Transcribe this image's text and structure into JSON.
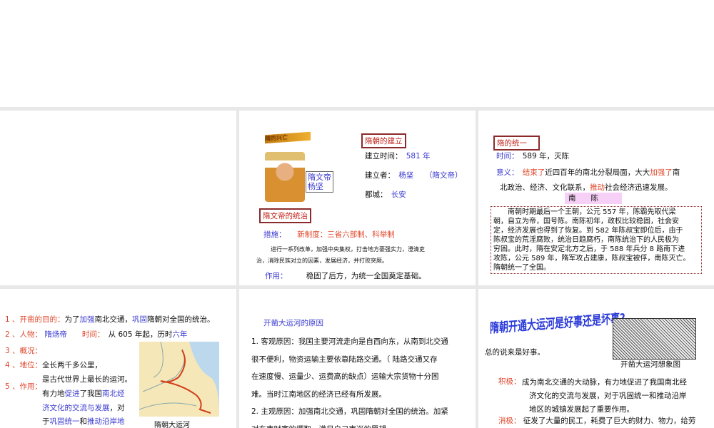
{
  "slide2": {
    "title_art": "隋的兴亡",
    "portrait_label_1": "隋文帝",
    "portrait_label_2": "杨坚",
    "founding_heading": "隋朝的建立",
    "time_label": "建立时间：",
    "time_value": "581 年",
    "founder_label": "建立者：",
    "founder_value": "杨坚",
    "founder_alias": "（隋文帝）",
    "capital_label": "都城：",
    "capital_value": "长安",
    "rule_heading": "隋文帝的统治",
    "measures_label": "措施：",
    "measures_value": "新制度：三省六部制、科举制",
    "detail_line1": "进行一系列改革，加强中央集权，打击地方豪强实力，澄清吏",
    "detail_line2": "治，消除民族对立的因素，发展经济，并打败突厥。",
    "effect_label": "作用：",
    "effect_value": "稳固了后方，为统一全国奠定基础。"
  },
  "slide3": {
    "heading": "隋的统一",
    "time_label": "时间：",
    "time_value": "589 年，灭陈",
    "meaning_label": "意义：",
    "m1": "结束了",
    "m2": "近四百年的南北分裂局面，大大",
    "m3": "加强了",
    "m4": "南",
    "m5": "北政治、经济、文化联系，",
    "m6": "推动",
    "m7": "社会经济迅速发展。",
    "chen_title": "南　　陈",
    "chen_lines": [
      "　　南朝时期最后一个王朝，公元 557 年，陈霸先取代梁",
      "朝，自立为帝，国号陈。南陈初年，政权比较稳固，社会安",
      "定，经济发展也得到了恢复。到 582 年陈叔宝即位后，由于",
      "陈叔宝的荒淫腐败，统治日趋腐朽，南陈统治下的人民极为",
      "穷困。此时，隋在安定北方之后，于 588 年兵分 8 路南下进",
      "攻陈，公元 589 年，隋军攻占建康，陈叔宝被俘，南陈灭亡。",
      "隋朝统一了全国。"
    ]
  },
  "slide4": {
    "l1a": "1 、开凿的目的：",
    "l1b": "为了",
    "l1c": "加强",
    "l1d": "南北交通，",
    "l1e": "巩固",
    "l1f": "隋朝对全国的统治。",
    "l2a": "2 、人物：",
    "l2b": "隋炀帝",
    "l2c": "时间：",
    "l2d": "从 605 年起，历时",
    "l2e": "六年",
    "l3": "3 、概况：",
    "l4a": "4 、地位：",
    "l4b": "全长两千多公里，",
    "l4c": "是古代世界上最长的运河。",
    "l5a": "5 、作用：",
    "r1a": "有力地",
    "r1b": "促进",
    "r1c": "了我国",
    "r1d": "南北经",
    "r2a": "济文化的交流与发展",
    "r2b": "，对",
    "r3a": "于",
    "r3b": "巩固统一",
    "r3c": "和",
    "r3d": "推动沿岸地",
    "map_caption": "隋朝大运河"
  },
  "slide5": {
    "heading": "开凿大运河的原因",
    "lines": [
      "1. 客观原因：我国主要河流走向是自西向东，从南到北交通",
      "很不便利，物资运输主要依靠陆路交通。（ 陆路交通又存",
      "在速度慢、运量少、运费高的缺点）运输大宗货物十分困",
      "难。当时江南地区的经济已经有所发展。",
      "2. 主观原因：加强南北交通，巩固隋朝对全国的统治。加紧",
      "对东南财富的攫取，满足自己南巡的愿望。"
    ]
  },
  "slide6": {
    "title_art": "隋朝开通大运河是好事还是坏事?",
    "summary": "总的说来是好事。",
    "image_caption": "开凿大运河想象图",
    "pos_label": "积极：",
    "pos_lines": [
      "成为南北交通的大动脉，有力地促进了我国南北经",
      "济文化的交流与发展，对于巩固统一和推动沿岸",
      "地区的城镇发展起了重要作用。"
    ],
    "neg_label": "消极：",
    "neg_line": "征发了大量的民工，耗费了巨大的财力、物力，给劳"
  }
}
